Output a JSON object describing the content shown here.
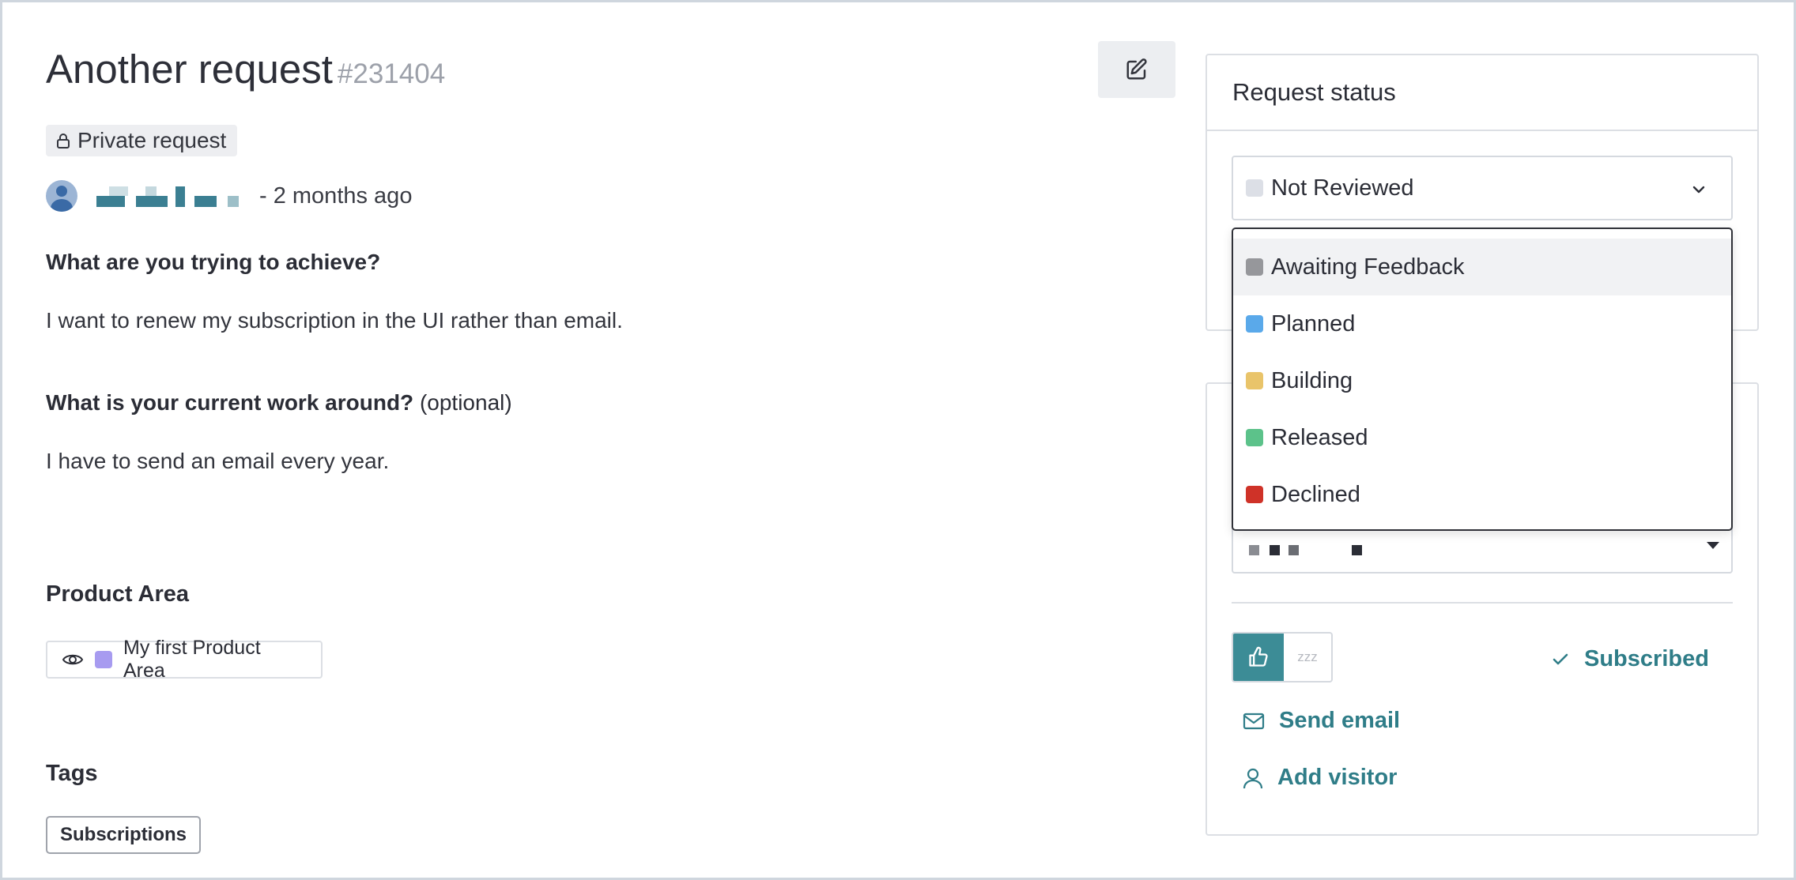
{
  "request": {
    "title": "Another request",
    "number": "#231404",
    "privacy_label": "Private request",
    "author_time": "- 2 months ago",
    "questions": [
      {
        "question": "What are you trying to achieve?",
        "answer": "I want to renew my subscription in the UI rather than email."
      },
      {
        "question": "What is your current work around?",
        "optional": "(optional)",
        "answer": "I have to send an email every year."
      }
    ],
    "product_area": {
      "heading": "Product Area",
      "chip_label": "My first Product Area",
      "chip_color": "#a79bf0"
    },
    "tags": {
      "heading": "Tags",
      "items": [
        "Subscriptions"
      ]
    }
  },
  "status_panel": {
    "heading": "Request status",
    "selected": {
      "label": "Not Reviewed",
      "color": "#dcdfe6"
    },
    "options": [
      {
        "label": "Awaiting Feedback",
        "color": "#96979b"
      },
      {
        "label": "Planned",
        "color": "#5aa9ea"
      },
      {
        "label": "Building",
        "color": "#e9c46a"
      },
      {
        "label": "Released",
        "color": "#5cc28a"
      },
      {
        "label": "Declined",
        "color": "#cf3228"
      }
    ]
  },
  "actions": {
    "subscribed_label": "Subscribed",
    "send_email_label": "Send email",
    "add_visitor_label": "Add visitor",
    "snooze_label": "zzz"
  },
  "icons": [
    "edit-icon",
    "lock-icon",
    "eye-icon",
    "chevron-down-icon",
    "thumbs-up-icon",
    "check-icon",
    "mail-icon",
    "user-icon"
  ],
  "colors": {
    "accent": "#3c8c96",
    "link": "#2f7d88"
  }
}
